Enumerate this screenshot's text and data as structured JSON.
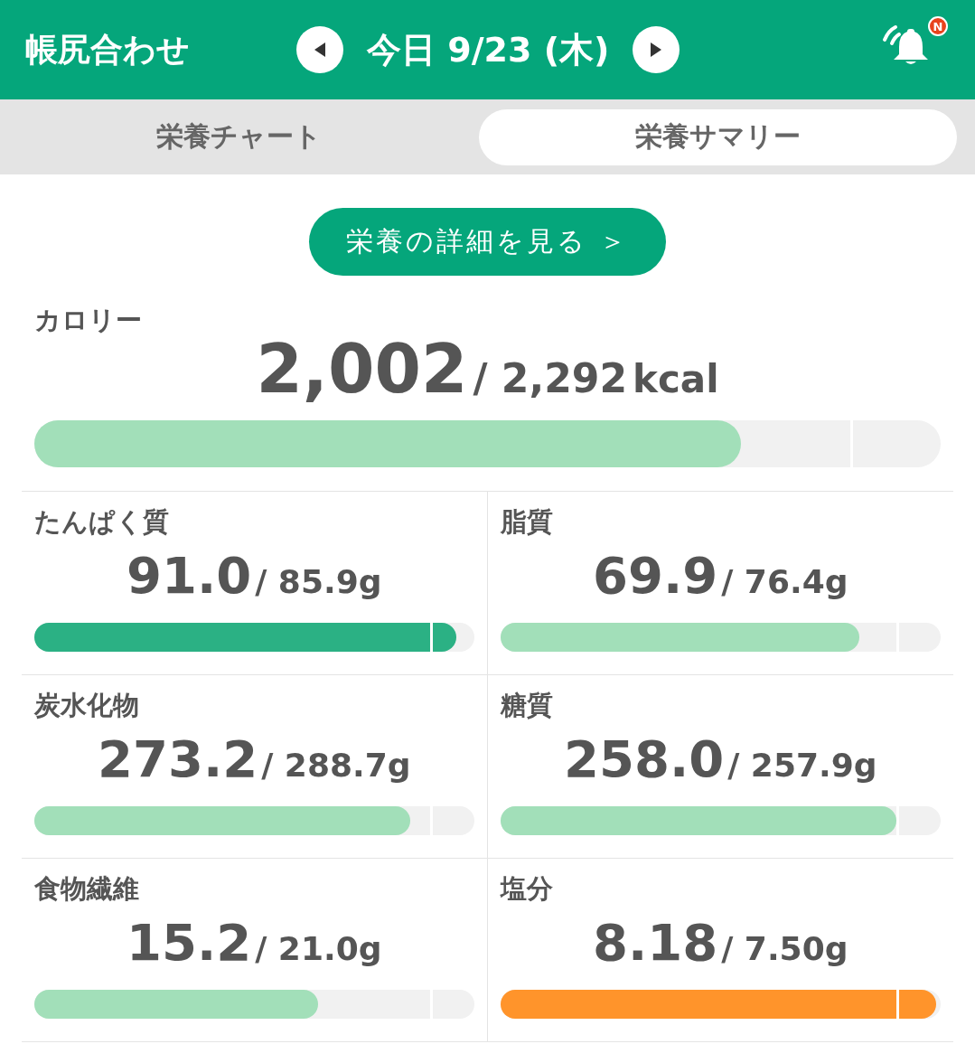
{
  "header": {
    "title": "帳尻合わせ",
    "date": "今日 9/23 (木)",
    "notification_badge": "N"
  },
  "tabs": [
    {
      "label": "栄養チャート",
      "selected": false
    },
    {
      "label": "栄養サマリー",
      "selected": true
    }
  ],
  "detail_button": "栄養の詳細を見る ＞",
  "calorie": {
    "label": "カロリー",
    "value": "2,002",
    "target": "/ 2,292",
    "unit": "kcal",
    "level": 0.78,
    "color": "#a2dfb9"
  },
  "nutrients": [
    {
      "label": "たんぱく質",
      "value": "91.0",
      "target": "/ 85.9g",
      "level": 0.96,
      "color": "#2bb184"
    },
    {
      "label": "脂質",
      "value": "69.9",
      "target": "/ 76.4g",
      "level": 0.815,
      "color": "#a2dfb9"
    },
    {
      "label": "炭水化物",
      "value": "273.2",
      "target": "/ 288.7g",
      "level": 0.855,
      "color": "#a2dfb9"
    },
    {
      "label": "糖質",
      "value": "258.0",
      "target": "/ 257.9g",
      "level": 0.9,
      "color": "#a2dfb9"
    },
    {
      "label": "食物繊維",
      "value": "15.2",
      "target": "/ 21.0g",
      "level": 0.645,
      "color": "#a2dfb9"
    },
    {
      "label": "塩分",
      "value": "8.18",
      "target": "/ 7.50g",
      "level": 0.99,
      "color": "#ff942b"
    }
  ]
}
